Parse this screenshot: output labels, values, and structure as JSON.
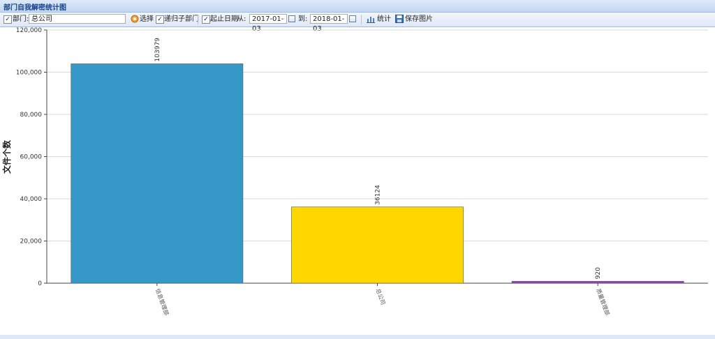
{
  "window": {
    "title": "部门自我解密统计图"
  },
  "toolbar": {
    "dept_checked": true,
    "dept_label": "部门:",
    "dept_value": "总公司",
    "select_label": "选择",
    "recursive_checked": true,
    "recursive_label": "递归子部门",
    "date_checked": true,
    "date_label": "起止日期",
    "from_label": "从:",
    "from_value": "2017-01-03",
    "to_label": "到:",
    "to_value": "2018-01-03",
    "stats_label": "统计",
    "save_label": "保存图片"
  },
  "chart_data": {
    "type": "bar",
    "title": "",
    "xlabel": "",
    "ylabel": "文件个数",
    "ylim": [
      0,
      120000
    ],
    "yticks": [
      0,
      20000,
      40000,
      60000,
      80000,
      100000,
      120000
    ],
    "ytick_labels": [
      "0",
      "20,000",
      "40,000",
      "60,000",
      "80,000",
      "100,000",
      "120,000"
    ],
    "grid": true,
    "categories": [
      "信息管理部",
      "总公司",
      "质量管理部"
    ],
    "values": [
      103979,
      36124,
      920
    ],
    "value_labels": [
      "103979",
      "36124",
      "920"
    ],
    "colors": [
      "#3598c6",
      "#ffd700",
      "#9b3fc2"
    ]
  }
}
